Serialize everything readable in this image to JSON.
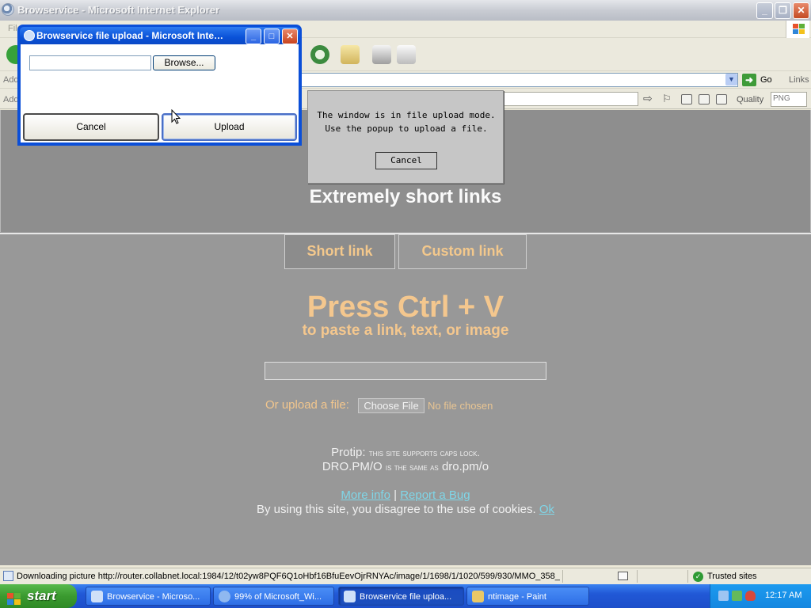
{
  "ie_window": {
    "title": "Browservice - Microsoft Internet Explorer",
    "menu_first": "File",
    "address_label": "Address",
    "go_label": "Go",
    "links_label": "Links",
    "plugin_address_label": "Address",
    "quality_label": "Quality",
    "quality_value": "PNG"
  },
  "upload_popup": {
    "title": "Browservice file upload - Microsoft Inte…",
    "file_path_value": "",
    "browse_label": "Browse...",
    "cancel_label": "Cancel",
    "upload_label": "Upload"
  },
  "mode_dialog": {
    "line1": "The window is in file upload mode.",
    "line2": "Use the popup to upload a file.",
    "cancel_label": "Cancel"
  },
  "site": {
    "title": "Extremely short links",
    "tabs": [
      "Short link",
      "Custom link"
    ],
    "headline": "Press Ctrl + V",
    "subheadline": "to paste a link, text, or image",
    "paste_value": "",
    "upload_label": "Or upload a file:",
    "choose_file_label": "Choose File",
    "no_file_label": "No file chosen",
    "protip_label": "Protip:",
    "protip_text": "this site supports caps lock.",
    "protip_example_a": "DRO.PM/O",
    "protip_example_mid": "is the same as",
    "protip_example_b": "dro.pm/o",
    "more_info_label": "More info",
    "separator": "|",
    "report_bug_label": "Report a Bug",
    "cookie_text": "By using this site, you disagree to the use of cookies.",
    "cookie_ok_label": "Ok"
  },
  "statusbar": {
    "text": "Downloading picture http://router.collabnet.local:1984/12/t02yw8PQF6Q1oHbf16BfuEevOjrRNYAc/image/1/1698/1/1020/599/930/MMO_358_",
    "zone": "Trusted sites"
  },
  "taskbar": {
    "start_label": "start",
    "tasks": [
      "Browservice - Microso...",
      "99% of Microsoft_Wi...",
      "Browservice file uploa...",
      "ntimage - Paint"
    ],
    "clock": "12:17 AM"
  },
  "colors": {
    "accent_orange": "#f4c78e",
    "link_cyan": "#7fd6e8",
    "page_gray": "#989898",
    "xp_blue": "#0b4fd8"
  },
  "icons": [
    "ie-logo-icon",
    "minimize-icon",
    "restore-icon",
    "close-icon",
    "refresh-icon",
    "mail-icon",
    "print-icon",
    "edit-icon",
    "go-arrow-icon",
    "dropdown-arrow-icon",
    "resize-grip-icon",
    "mouse-cursor-icon",
    "shield-check-icon",
    "windows-flag-icon"
  ]
}
